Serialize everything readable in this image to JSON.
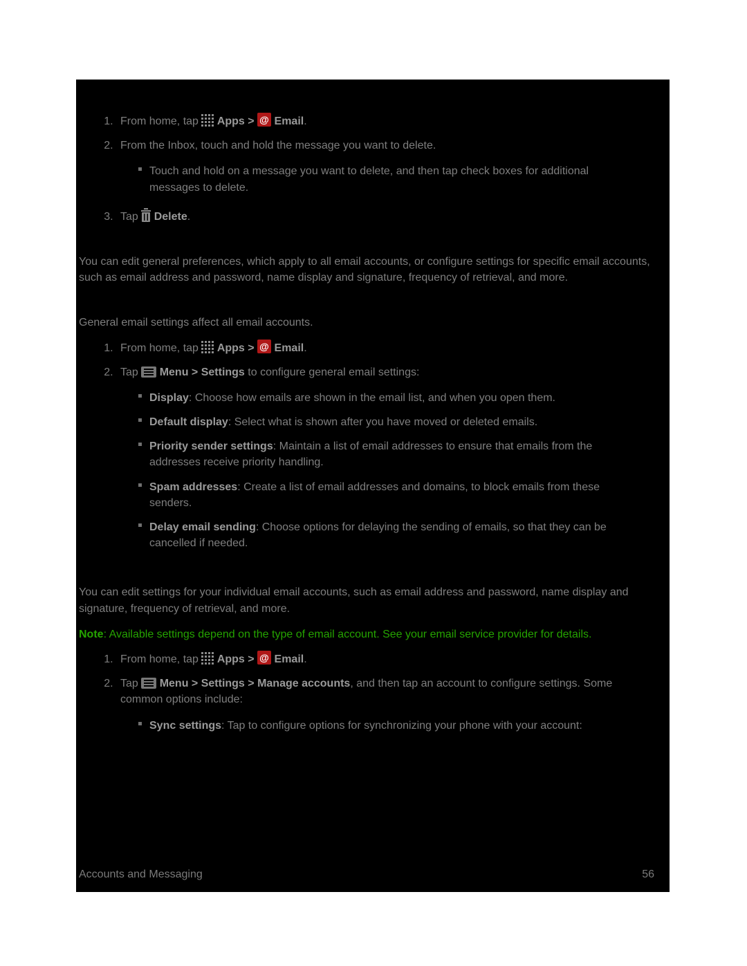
{
  "section1": {
    "step1_prefix": "From home, tap ",
    "apps_label": "Apps > ",
    "email_label": "Email",
    "step1_suffix": ".",
    "step2": "From the Inbox, touch and hold the message you want to delete.",
    "step2_sub1": "Touch and hold on a message you want to delete, and then tap check boxes for additional messages to delete.",
    "step3_prefix": "Tap ",
    "delete_label": "Delete",
    "step3_suffix": "."
  },
  "intro1": "You can edit general preferences, which apply to all email accounts, or configure settings for specific email accounts, such as email address and password, name display and signature, frequency of retrieval, and more.",
  "intro2": "General email settings affect all email accounts.",
  "section2": {
    "step1_prefix": "From home, tap ",
    "apps_label": "Apps > ",
    "email_label": "Email",
    "step1_suffix": ".",
    "step2_prefix": "Tap ",
    "menu_settings": "Menu > Settings",
    "step2_suffix": " to configure general email settings:",
    "bullet1_b": "Display",
    "bullet1": ": Choose how emails are shown in the email list, and when you open them.",
    "bullet2_b": "Default display",
    "bullet2": ": Select what is shown after you have moved or deleted emails.",
    "bullet3_b": "Priority sender settings",
    "bullet3": ": Maintain a list of email addresses to ensure that emails from the addresses receive priority handling.",
    "bullet4_b": "Spam addresses",
    "bullet4": ": Create a list of email addresses and domains, to block emails from these senders.",
    "bullet5_b": "Delay email sending",
    "bullet5": ": Choose options for delaying the sending of emails, so that they can be cancelled if needed."
  },
  "intro3": "You can edit settings for your individual email accounts, such as email address and password, name display and signature, frequency of retrieval, and more.",
  "note_label": "Note",
  "note_text": ": Available settings depend on the type of email account. See your email service provider for details.",
  "section3": {
    "step1_prefix": "From home, tap ",
    "apps_label": "Apps > ",
    "email_label": "Email",
    "step1_suffix": ".",
    "step2_prefix": "Tap ",
    "menu_path": "Menu > Settings > Manage accounts",
    "step2_suffix": ", and then tap an account to configure settings. Some common options include:",
    "bullet1_b": "Sync settings",
    "bullet1": ": Tap to configure options for synchronizing your phone with your account:"
  },
  "footer_left": "Accounts and Messaging",
  "footer_right": "56"
}
